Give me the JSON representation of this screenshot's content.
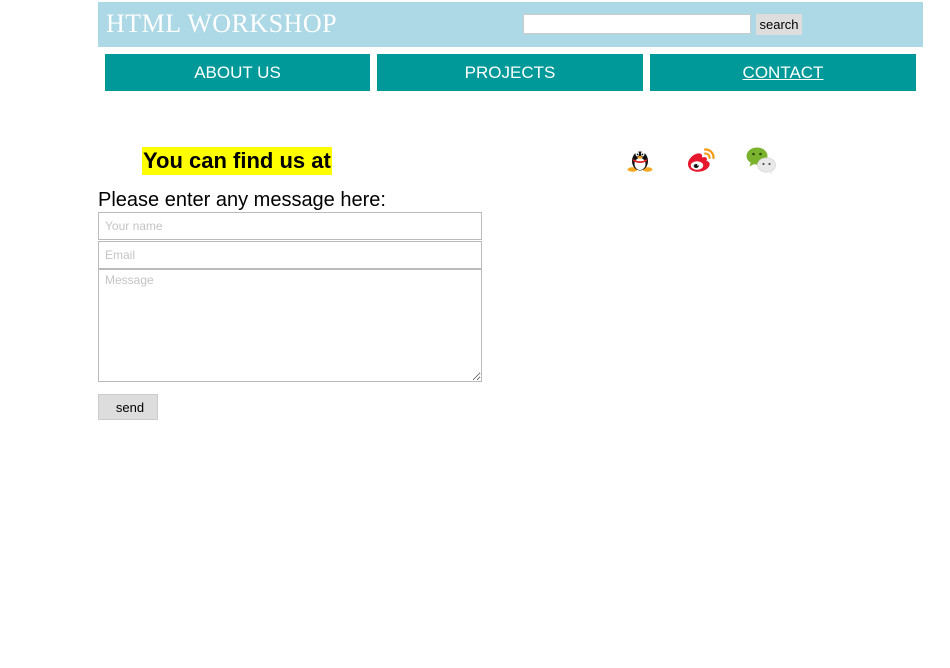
{
  "header": {
    "title": "HTML WORKSHOP",
    "search_value": "",
    "search_button_label": "search"
  },
  "nav": {
    "items": [
      {
        "label": "ABOUT US",
        "active": false
      },
      {
        "label": "PROJECTS",
        "active": false
      },
      {
        "label": "CONTACT",
        "active": true
      }
    ]
  },
  "contact": {
    "heading": "You can find us at",
    "social_icons": [
      "qq-icon",
      "weibo-icon",
      "wechat-icon"
    ],
    "prompt": "Please enter any message here:",
    "name_placeholder": "Your name",
    "email_placeholder": "Email",
    "message_placeholder": "Message",
    "send_label": "send"
  },
  "colors": {
    "header_bg": "#add8e6",
    "nav_bg": "#009999",
    "highlight": "#ffff00"
  }
}
